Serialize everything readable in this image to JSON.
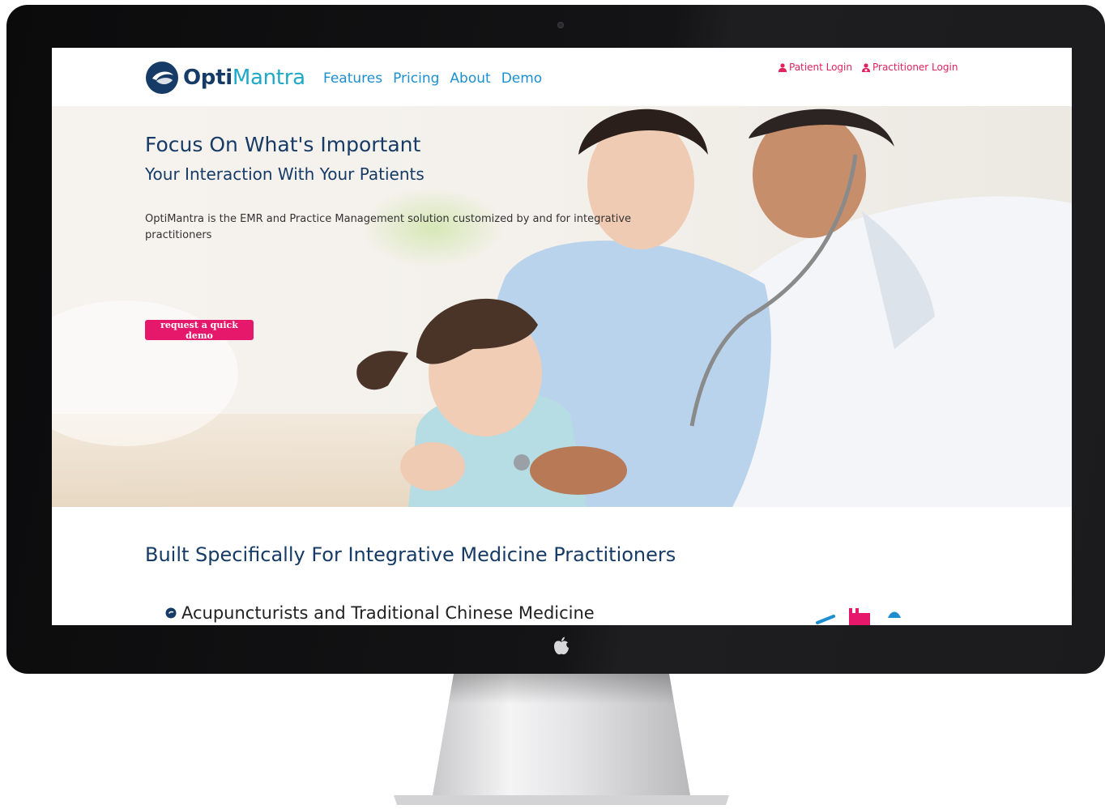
{
  "brand": {
    "opti": "Opti",
    "mantra": "Mantra"
  },
  "nav": {
    "items": [
      {
        "label": "Features"
      },
      {
        "label": "Pricing"
      },
      {
        "label": "About"
      },
      {
        "label": "Demo"
      }
    ]
  },
  "login": {
    "patient": "Patient Login",
    "practitioner": "Practitioner Login"
  },
  "hero": {
    "title": "Focus On What's Important",
    "subtitle": "Your Interaction With Your Patients",
    "description": "OptiMantra is the EMR and Practice Management solution customized by and for integrative practitioners",
    "cta": "request a quick demo"
  },
  "practitioners": {
    "title": "Built Specifically For Integrative Medicine Practitioners",
    "items": [
      {
        "label": "Acupuncturists and Traditional Chinese Medicine"
      }
    ]
  },
  "colors": {
    "navy": "#163b66",
    "link_blue": "#1d8fd1",
    "accent_pink": "#e6186b",
    "logo_teal": "#1fa9c8"
  },
  "icons": {
    "login": "user-icon",
    "list_bullet": "circle-arrow-icon",
    "device": "apple-logo-icon"
  }
}
